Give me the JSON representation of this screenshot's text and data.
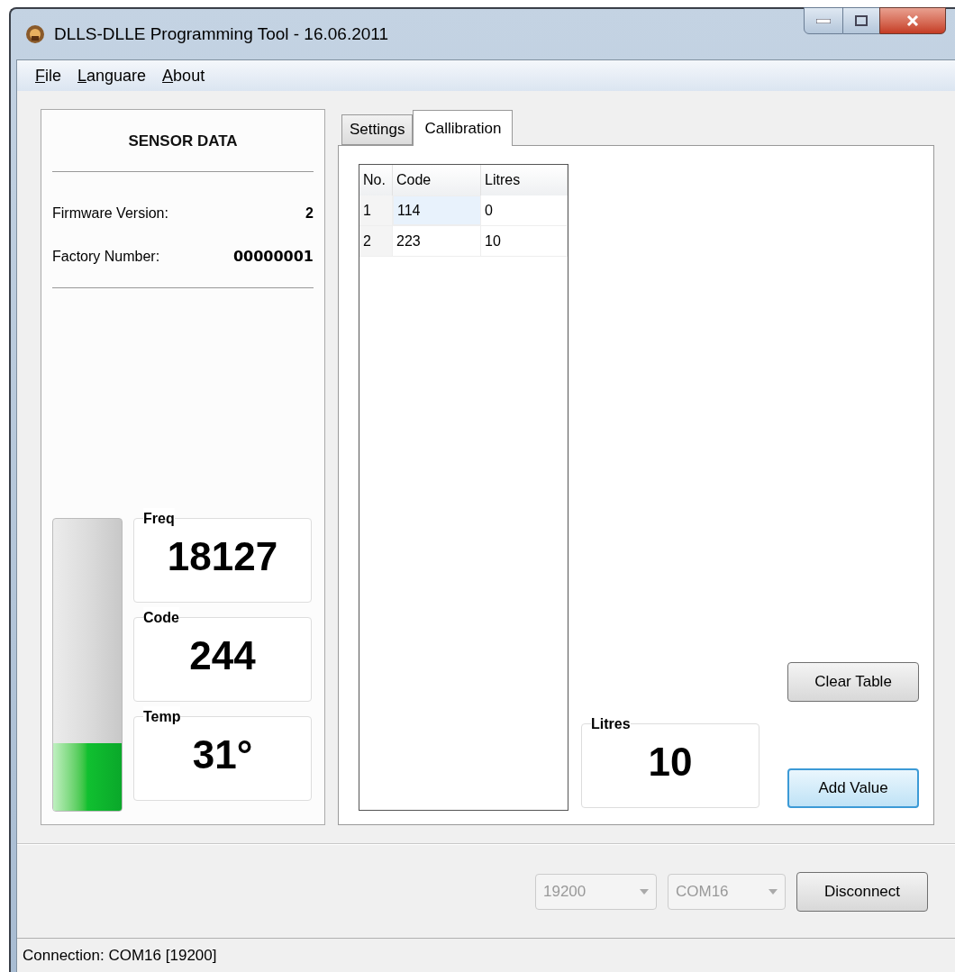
{
  "window": {
    "title": "DLLS-DLLE Programming Tool - 16.06.2011"
  },
  "menu": [
    {
      "label": "File"
    },
    {
      "label": "Languare"
    },
    {
      "label": "About"
    }
  ],
  "sensor_data": {
    "heading": "SENSOR DATA",
    "firmware_label": "Firmware Version:",
    "firmware_value": "2",
    "factory_label": "Factory Number:",
    "factory_value": "00000001",
    "level": 0.23,
    "readouts": [
      {
        "label": "Freq",
        "value": "18127"
      },
      {
        "label": "Code",
        "value": "244"
      },
      {
        "label": "Temp",
        "value": "31°"
      }
    ]
  },
  "tabs": [
    {
      "label": "Settings",
      "selected": false
    },
    {
      "label": "Callibration",
      "selected": true
    }
  ],
  "table": {
    "columns": [
      "No.",
      "Code",
      "Litres"
    ],
    "rows": [
      {
        "cells": [
          {
            "text": "1",
            "selected": false
          },
          {
            "text": "114",
            "selected": true
          },
          {
            "text": "0",
            "selected": false
          }
        ]
      },
      {
        "cells": [
          {
            "text": "2",
            "selected": false
          },
          {
            "text": "223",
            "selected": false
          },
          {
            "text": "10",
            "selected": false
          }
        ]
      }
    ]
  },
  "litres": {
    "label": "Litres",
    "value": "10"
  },
  "buttons": [
    {
      "label": "Clear Table",
      "focused": false
    },
    {
      "label": "Add Value",
      "focused": true
    }
  ],
  "connection": {
    "baud": {
      "value": "19200",
      "disabled": true
    },
    "port": {
      "value": "COM16",
      "disabled": true
    },
    "button": "Disconnect"
  },
  "status_bar": "Connection: COM16 [19200]"
}
